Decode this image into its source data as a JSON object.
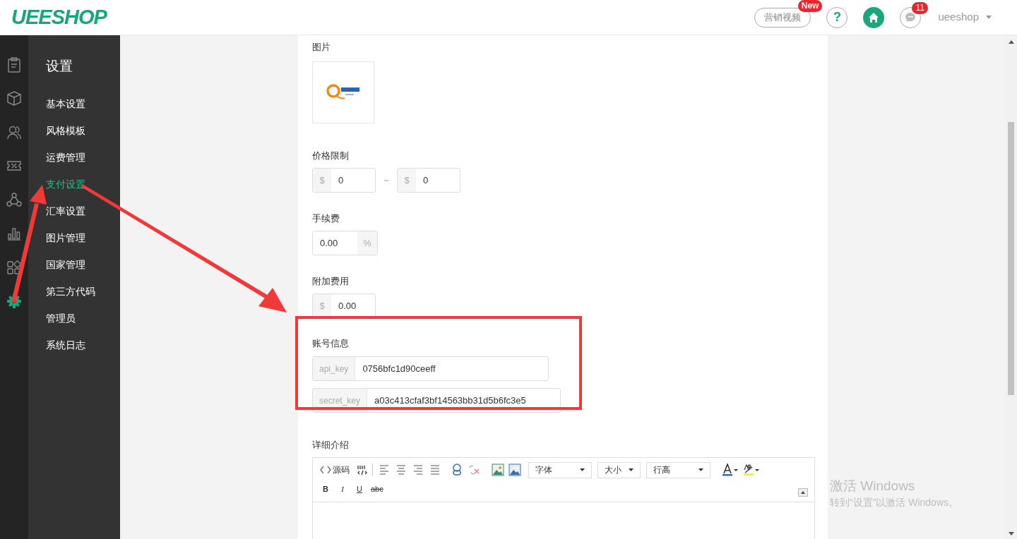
{
  "logo": "UEESHOP",
  "header": {
    "video_button": "营销视频",
    "new_badge": "New",
    "help": "?",
    "messages_count": "11",
    "user": "ueeshop"
  },
  "rail_icons": [
    {
      "kind": "clipboard",
      "selected": false
    },
    {
      "kind": "box",
      "selected": false
    },
    {
      "kind": "users",
      "selected": false
    },
    {
      "kind": "coupon",
      "selected": false
    },
    {
      "kind": "network",
      "selected": false
    },
    {
      "kind": "chart",
      "selected": false
    },
    {
      "kind": "apps",
      "selected": false
    },
    {
      "kind": "gear",
      "selected": true
    }
  ],
  "menu": {
    "title": "设置",
    "items": [
      {
        "label": "基本设置",
        "selected": false
      },
      {
        "label": "风格模板",
        "selected": false
      },
      {
        "label": "运费管理",
        "selected": false
      },
      {
        "label": "支付设置",
        "selected": true
      },
      {
        "label": "汇率设置",
        "selected": false
      },
      {
        "label": "图片管理",
        "selected": false
      },
      {
        "label": "国家管理",
        "selected": false
      },
      {
        "label": "第三方代码",
        "selected": false
      },
      {
        "label": "管理员",
        "selected": false
      },
      {
        "label": "系统日志",
        "selected": false
      }
    ]
  },
  "form": {
    "image": {
      "label": "图片",
      "kind": "picture"
    },
    "price_limit": {
      "label": "价格限制",
      "min_prefix": "$",
      "min": "0",
      "separator": "~",
      "max_prefix": "$",
      "max": "0"
    },
    "fee": {
      "label": "手续费",
      "value": "0.00",
      "suffix": "%"
    },
    "extra_fee": {
      "label": "附加费用",
      "prefix": "$",
      "value": "0.00"
    },
    "account": {
      "label": "账号信息",
      "fields": [
        {
          "name": "api_key",
          "value": "0756bfc1d90ceeff"
        },
        {
          "name": "secret_key",
          "value": "a03c413cfaf3bf14563bb31d5b6fc3e5"
        }
      ]
    },
    "description": {
      "label": "详细介绍",
      "source_button": "源码",
      "font_select": "字体",
      "size_select": "大小",
      "line_height_select": "行高",
      "format_buttons": [
        "B",
        "I",
        "U",
        "abc"
      ]
    }
  },
  "activation_notice": {
    "title": "激活 Windows",
    "message": "转到“设置”以激活 Windows。"
  }
}
